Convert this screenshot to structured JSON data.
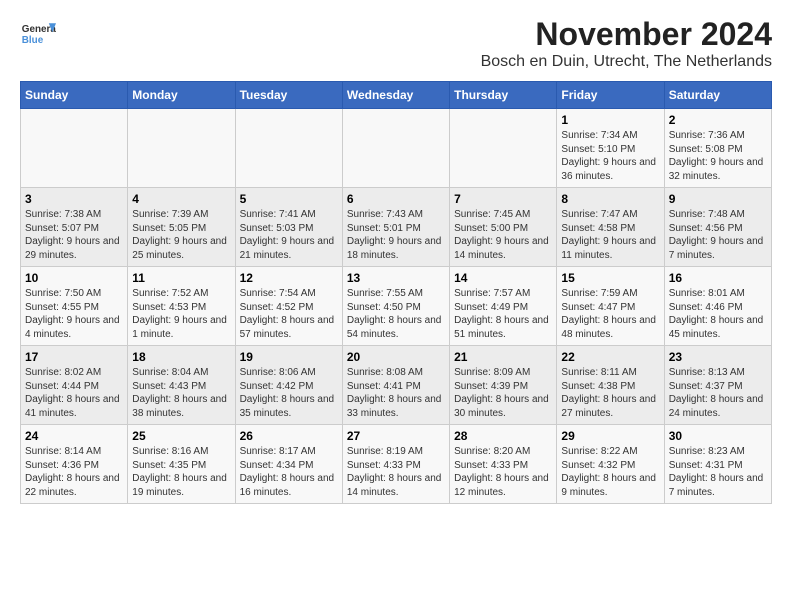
{
  "header": {
    "logo_line1": "General",
    "logo_line2": "Blue",
    "month": "November 2024",
    "location": "Bosch en Duin, Utrecht, The Netherlands"
  },
  "weekdays": [
    "Sunday",
    "Monday",
    "Tuesday",
    "Wednesday",
    "Thursday",
    "Friday",
    "Saturday"
  ],
  "weeks": [
    [
      {
        "day": "",
        "info": ""
      },
      {
        "day": "",
        "info": ""
      },
      {
        "day": "",
        "info": ""
      },
      {
        "day": "",
        "info": ""
      },
      {
        "day": "",
        "info": ""
      },
      {
        "day": "1",
        "info": "Sunrise: 7:34 AM\nSunset: 5:10 PM\nDaylight: 9 hours and 36 minutes."
      },
      {
        "day": "2",
        "info": "Sunrise: 7:36 AM\nSunset: 5:08 PM\nDaylight: 9 hours and 32 minutes."
      }
    ],
    [
      {
        "day": "3",
        "info": "Sunrise: 7:38 AM\nSunset: 5:07 PM\nDaylight: 9 hours and 29 minutes."
      },
      {
        "day": "4",
        "info": "Sunrise: 7:39 AM\nSunset: 5:05 PM\nDaylight: 9 hours and 25 minutes."
      },
      {
        "day": "5",
        "info": "Sunrise: 7:41 AM\nSunset: 5:03 PM\nDaylight: 9 hours and 21 minutes."
      },
      {
        "day": "6",
        "info": "Sunrise: 7:43 AM\nSunset: 5:01 PM\nDaylight: 9 hours and 18 minutes."
      },
      {
        "day": "7",
        "info": "Sunrise: 7:45 AM\nSunset: 5:00 PM\nDaylight: 9 hours and 14 minutes."
      },
      {
        "day": "8",
        "info": "Sunrise: 7:47 AM\nSunset: 4:58 PM\nDaylight: 9 hours and 11 minutes."
      },
      {
        "day": "9",
        "info": "Sunrise: 7:48 AM\nSunset: 4:56 PM\nDaylight: 9 hours and 7 minutes."
      }
    ],
    [
      {
        "day": "10",
        "info": "Sunrise: 7:50 AM\nSunset: 4:55 PM\nDaylight: 9 hours and 4 minutes."
      },
      {
        "day": "11",
        "info": "Sunrise: 7:52 AM\nSunset: 4:53 PM\nDaylight: 9 hours and 1 minute."
      },
      {
        "day": "12",
        "info": "Sunrise: 7:54 AM\nSunset: 4:52 PM\nDaylight: 8 hours and 57 minutes."
      },
      {
        "day": "13",
        "info": "Sunrise: 7:55 AM\nSunset: 4:50 PM\nDaylight: 8 hours and 54 minutes."
      },
      {
        "day": "14",
        "info": "Sunrise: 7:57 AM\nSunset: 4:49 PM\nDaylight: 8 hours and 51 minutes."
      },
      {
        "day": "15",
        "info": "Sunrise: 7:59 AM\nSunset: 4:47 PM\nDaylight: 8 hours and 48 minutes."
      },
      {
        "day": "16",
        "info": "Sunrise: 8:01 AM\nSunset: 4:46 PM\nDaylight: 8 hours and 45 minutes."
      }
    ],
    [
      {
        "day": "17",
        "info": "Sunrise: 8:02 AM\nSunset: 4:44 PM\nDaylight: 8 hours and 41 minutes."
      },
      {
        "day": "18",
        "info": "Sunrise: 8:04 AM\nSunset: 4:43 PM\nDaylight: 8 hours and 38 minutes."
      },
      {
        "day": "19",
        "info": "Sunrise: 8:06 AM\nSunset: 4:42 PM\nDaylight: 8 hours and 35 minutes."
      },
      {
        "day": "20",
        "info": "Sunrise: 8:08 AM\nSunset: 4:41 PM\nDaylight: 8 hours and 33 minutes."
      },
      {
        "day": "21",
        "info": "Sunrise: 8:09 AM\nSunset: 4:39 PM\nDaylight: 8 hours and 30 minutes."
      },
      {
        "day": "22",
        "info": "Sunrise: 8:11 AM\nSunset: 4:38 PM\nDaylight: 8 hours and 27 minutes."
      },
      {
        "day": "23",
        "info": "Sunrise: 8:13 AM\nSunset: 4:37 PM\nDaylight: 8 hours and 24 minutes."
      }
    ],
    [
      {
        "day": "24",
        "info": "Sunrise: 8:14 AM\nSunset: 4:36 PM\nDaylight: 8 hours and 22 minutes."
      },
      {
        "day": "25",
        "info": "Sunrise: 8:16 AM\nSunset: 4:35 PM\nDaylight: 8 hours and 19 minutes."
      },
      {
        "day": "26",
        "info": "Sunrise: 8:17 AM\nSunset: 4:34 PM\nDaylight: 8 hours and 16 minutes."
      },
      {
        "day": "27",
        "info": "Sunrise: 8:19 AM\nSunset: 4:33 PM\nDaylight: 8 hours and 14 minutes."
      },
      {
        "day": "28",
        "info": "Sunrise: 8:20 AM\nSunset: 4:33 PM\nDaylight: 8 hours and 12 minutes."
      },
      {
        "day": "29",
        "info": "Sunrise: 8:22 AM\nSunset: 4:32 PM\nDaylight: 8 hours and 9 minutes."
      },
      {
        "day": "30",
        "info": "Sunrise: 8:23 AM\nSunset: 4:31 PM\nDaylight: 8 hours and 7 minutes."
      }
    ]
  ]
}
